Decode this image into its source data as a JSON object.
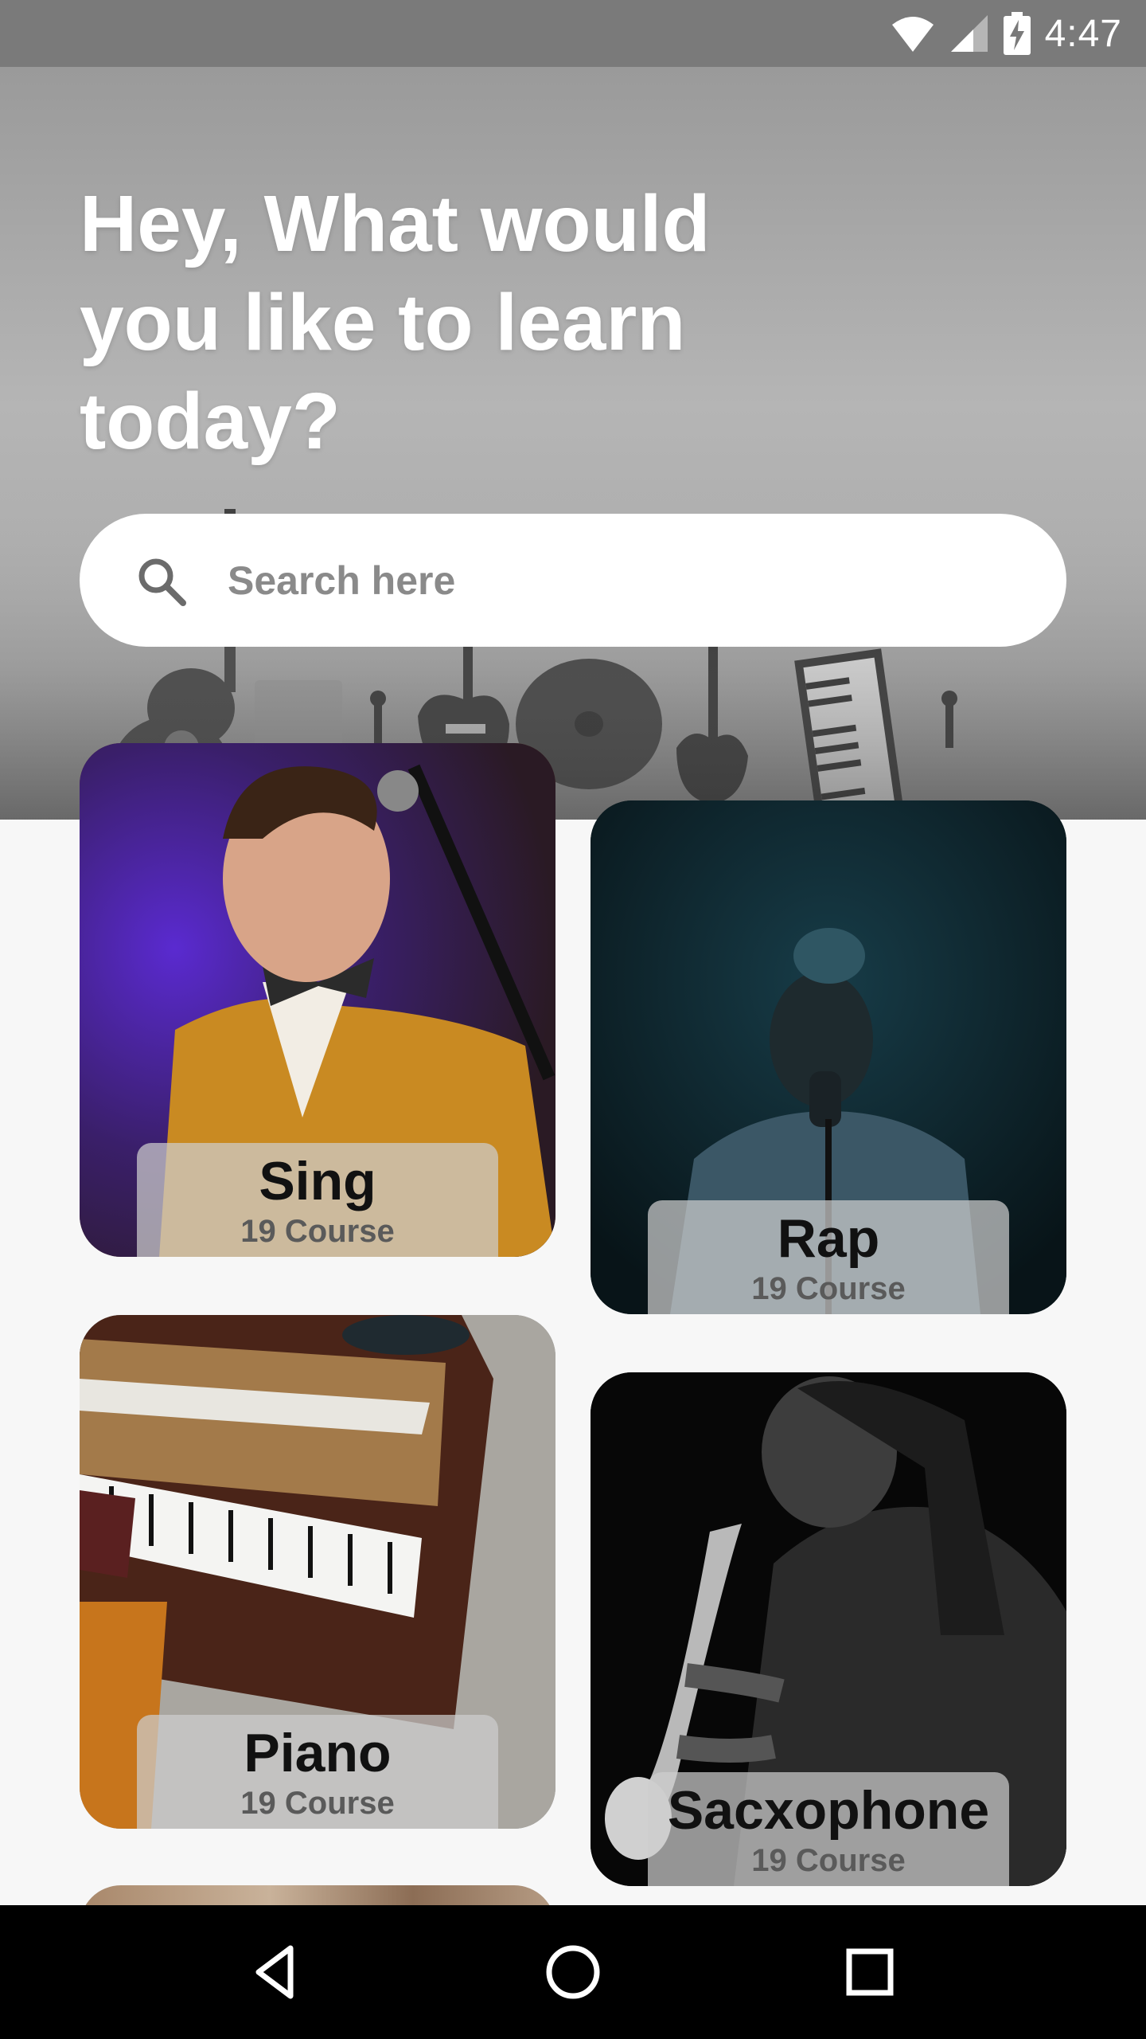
{
  "status_bar": {
    "time": "4:47"
  },
  "header": {
    "headline": "Hey, What would you like to learn today?"
  },
  "search": {
    "placeholder": "Search here"
  },
  "categories": [
    {
      "title": "Sing",
      "count": "19 Course"
    },
    {
      "title": "Rap",
      "count": "19 Course"
    },
    {
      "title": "Piano",
      "count": "19 Course"
    },
    {
      "title": "Sacxophone",
      "count": "19 Course"
    }
  ],
  "icons": {
    "status": [
      "wifi-icon",
      "signal-icon",
      "battery-charging-icon"
    ],
    "search": "search-icon",
    "nav": [
      "back-icon",
      "home-icon",
      "recents-icon"
    ]
  }
}
